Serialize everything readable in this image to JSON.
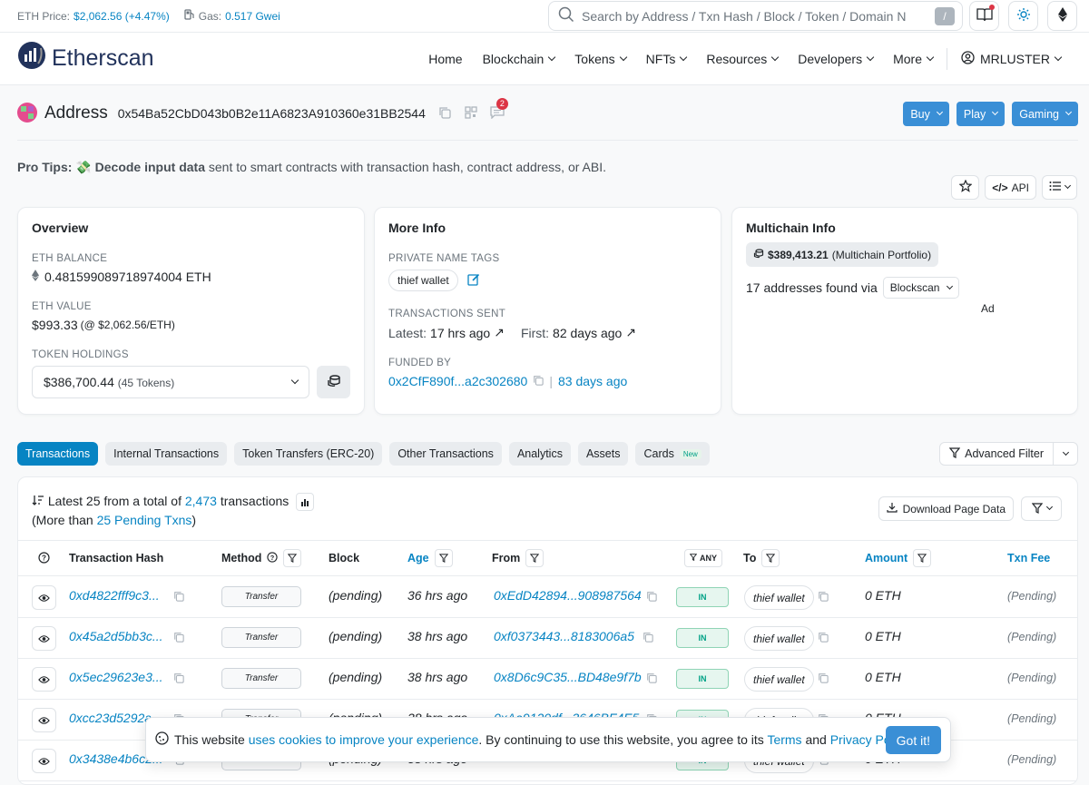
{
  "topbar": {
    "eth_price_label": "ETH Price:",
    "eth_price_value": "$2,062.56 (+4.47%)",
    "gas_label": "Gas:",
    "gas_value": "0.517 Gwei",
    "search_placeholder": "Search by Address / Txn Hash / Block / Token / Domain N",
    "search_shortcut": "/"
  },
  "brand": {
    "name": "Etherscan"
  },
  "nav": {
    "items": [
      "Home",
      "Blockchain",
      "Tokens",
      "NFTs",
      "Resources",
      "Developers",
      "More"
    ],
    "user": "MRLUSTER"
  },
  "address": {
    "title": "Address",
    "hash": "0x54Ba52CbD043b0B2e11A6823A910360e31BB2544",
    "comment_count": "2"
  },
  "header_buttons": [
    "Buy",
    "Play",
    "Gaming"
  ],
  "protips": {
    "label": "Pro Tips:",
    "link": "Decode input data",
    "rest": "sent to smart contracts with transaction hash, contract address, or ABI."
  },
  "tools": {
    "api": "API"
  },
  "overview": {
    "title": "Overview",
    "balance_label": "ETH BALANCE",
    "balance_value": "0.481599089718974004 ETH",
    "value_label": "ETH VALUE",
    "value_main": "$993.33",
    "value_sub": "(@ $2,062.56/ETH)",
    "holdings_label": "TOKEN HOLDINGS",
    "holdings_main": "$386,700.44",
    "holdings_sub": "(45 Tokens)"
  },
  "moreinfo": {
    "title": "More Info",
    "tags_label": "PRIVATE NAME TAGS",
    "tag": "thief wallet",
    "sent_label": "TRANSACTIONS SENT",
    "latest_label": "Latest:",
    "latest_value": "17 hrs ago",
    "first_label": "First:",
    "first_value": "82 days ago",
    "funded_label": "FUNDED BY",
    "funded_addr": "0x2CfF890f...a2c302680",
    "funded_age": "83 days ago"
  },
  "multichain": {
    "title": "Multichain Info",
    "portfolio_value": "$389,413.21",
    "portfolio_label": "(Multichain Portfolio)",
    "found_text": "17 addresses found via",
    "found_select": "Blockscan",
    "ad": "Ad"
  },
  "tabs": [
    "Transactions",
    "Internal Transactions",
    "Token Transfers (ERC-20)",
    "Other Transactions",
    "Analytics",
    "Assets",
    "Cards"
  ],
  "tabs_new": "New",
  "advanced_filter": "Advanced Filter",
  "txsummary": {
    "line1_pre": "Latest 25 from a total of",
    "total": "2,473",
    "line1_post": "transactions",
    "line2_pre": "(More than",
    "pending_link": "25 Pending Txns",
    "line2_post": ")",
    "download": "Download Page Data"
  },
  "columns": {
    "hash": "Transaction Hash",
    "method": "Method",
    "block": "Block",
    "age": "Age",
    "from": "From",
    "any": "ANY",
    "to": "To",
    "amount": "Amount",
    "fee": "Txn Fee"
  },
  "rows": [
    {
      "hash": "0xd4822fff9c3...",
      "method": "Transfer",
      "block": "(pending)",
      "age": "36 hrs ago",
      "from": "0xEdD42894...908987564",
      "dir": "IN",
      "to": "thief wallet",
      "amount": "0 ETH",
      "fee": "(Pending)"
    },
    {
      "hash": "0x45a2d5bb3c...",
      "method": "Transfer",
      "block": "(pending)",
      "age": "38 hrs ago",
      "from": "0xf0373443...8183006a5",
      "dir": "IN",
      "to": "thief wallet",
      "amount": "0 ETH",
      "fee": "(Pending)"
    },
    {
      "hash": "0x5ec29623e3...",
      "method": "Transfer",
      "block": "(pending)",
      "age": "38 hrs ago",
      "from": "0x8D6c9C35...BD48e9f7b",
      "dir": "IN",
      "to": "thief wallet",
      "amount": "0 ETH",
      "fee": "(Pending)"
    },
    {
      "hash": "0xcc23d5292a...",
      "method": "Transfer",
      "block": "(pending)",
      "age": "38 hrs ago",
      "from": "0xAa9120df...3646BF4E5",
      "dir": "IN",
      "to": "thief wallet",
      "amount": "0 ETH",
      "fee": "(Pending)"
    },
    {
      "hash": "0x3438e4b6c2...",
      "method": "Transfer",
      "block": "(pending)",
      "age": "38 hrs ago",
      "from": "",
      "dir": "IN",
      "to": "thief wallet",
      "amount": "0 ETH",
      "fee": "(Pending)"
    }
  ],
  "cookie": {
    "pre": "This website",
    "link1": "uses cookies to improve your experience",
    "mid": ". By continuing to use this website, you agree to its",
    "terms": "Terms",
    "and": "and",
    "privacy": "Privacy Policy",
    "end": ".",
    "button": "Got it!"
  }
}
